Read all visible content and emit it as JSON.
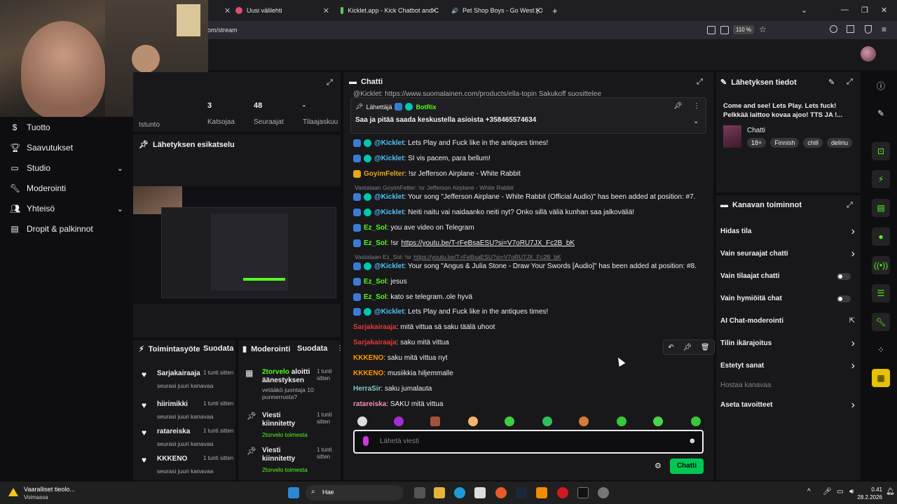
{
  "browser": {
    "tabs": [
      {
        "label": "Uusi välilehti"
      },
      {
        "label": "Kicklet.app - Kick Chatbot and C"
      },
      {
        "label": "Pet Shop Boys - Go West (Of"
      }
    ],
    "new_tab": "+",
    "url": "om/stream",
    "zoom": "110 %"
  },
  "leftnav": {
    "items": [
      {
        "label": "Tuotto",
        "icon": "dollar-icon"
      },
      {
        "label": "Saavutukset",
        "icon": "trophy-icon"
      },
      {
        "label": "Studio",
        "icon": "monitor-icon"
      },
      {
        "label": "Moderointi",
        "icon": "wrench-icon"
      },
      {
        "label": "Yhteisö",
        "icon": "users-icon"
      },
      {
        "label": "Dropit & palkinnot",
        "icon": "gift-icon"
      }
    ]
  },
  "stats": {
    "session_value": "3",
    "followers_value": "48",
    "subs_value": "-",
    "labels": [
      "Istunto",
      "Katsojaa",
      "Seuraajat",
      "Tilaajaskuu"
    ]
  },
  "preview": {
    "title": "Lähetyksen esikatselu"
  },
  "activity": {
    "title": "Toimintasyöte",
    "filter": "Suodata",
    "items": [
      {
        "name": "Sarjakairaaja",
        "time": "1 tunti sitten",
        "desc": "seurasi juuri kanavaa"
      },
      {
        "name": "hiirimikki",
        "time": "1 tunti sitten",
        "desc": "seurasi juuri kanavaa"
      },
      {
        "name": "ratareiska",
        "time": "1 tunti sitten",
        "desc": "seurasi juuri kanavaa"
      },
      {
        "name": "KKKENO",
        "time": "1 tunti sitten",
        "desc": "seurasi juuri kanavaa"
      }
    ]
  },
  "modlog": {
    "title": "Moderointi",
    "filter": "Suodata",
    "items": [
      {
        "user": "2torvelo",
        "text": "aloitti äänestyksen",
        "time": "1 tunti sitten",
        "desc": "vetääkö juontaja 10 punnerrusta?"
      },
      {
        "user": "",
        "text": "Viesti kiinnitetty",
        "time": "1 tunti sitten",
        "desc": "2torvelo toimesta"
      },
      {
        "user": "",
        "text": "Viesti kiinnitetty",
        "time": "1 tunti sitten",
        "desc": "2torvelo toimesta"
      }
    ]
  },
  "chat": {
    "title": "Chatti",
    "top_partial": "@Kicklet: https://www.suomalainen.com/products/ella-topin Sakukoff suosittelee",
    "pinned": {
      "sender_label": "Lähettäjä",
      "sender": "BotRix",
      "message": "Saa ja pitää saada keskustella asioista +358465574634"
    },
    "messages": [
      {
        "user": "@Kicklet",
        "color": "#4fc3f7",
        "text": ": Lets Play and Fuck like in the antiques times!"
      },
      {
        "user": "@Kicklet",
        "color": "#4fc3f7",
        "text": ": SI vis pacem, para bellum!"
      },
      {
        "user": "GoyimFelter",
        "color": "#e6a817",
        "text": ": !sr Jefferson Airplane - White Rabbit"
      },
      {
        "reply": "Vastataan GoyimFelter: !sr Jefferson Airplane - White Rabbit"
      },
      {
        "user": "@Kicklet",
        "color": "#4fc3f7",
        "text": ": Your song \"Jefferson Airplane - White Rabbit (Official Audio)\" has been added at position: #7."
      },
      {
        "user": "@Kicklet",
        "color": "#4fc3f7",
        "text": ": Neiti naitu vai naidaanko neiti nyt? Onko sillä väliä kunhan saa jalkoväliä!"
      },
      {
        "user": "Ez_Sol",
        "color": "#53fc18",
        "text": ": you ave video on Telegram"
      },
      {
        "user": "Ez_Sol",
        "color": "#53fc18",
        "text": ": !sr",
        "link": "https://youtu.be/T-rFeBsaESU?si=V7oRU7JX_Fc2B_bK"
      },
      {
        "reply": "Vastataan Ez_Sol: !sr",
        "reply_link": "https://youtu.be/T-rFeBsaESU?si=V7oRU7JX_Fc2B_bK"
      },
      {
        "user": "@Kicklet",
        "color": "#4fc3f7",
        "text": ": Your song \"Angus & Julia Stone - Draw Your Swords [Audio]\" has been added at position: #8."
      },
      {
        "user": "Ez_Sol",
        "color": "#53fc18",
        "text": ": jesus"
      },
      {
        "user": "Ez_Sol",
        "color": "#53fc18",
        "text": ": kato se telegram..ole hyvä"
      },
      {
        "user": "@Kicklet",
        "color": "#4fc3f7",
        "text": ": Lets Play and Fuck like in the antiques times!"
      },
      {
        "user": "Sarjakairaaja",
        "color": "#e53935",
        "text": ": mitä vittua sä saku täälä uhoot"
      },
      {
        "user": "Sarjakairaaja",
        "color": "#e53935",
        "text": ": saku mitä vittua"
      },
      {
        "user": "KKKENO",
        "color": "#ff9800",
        "text": ": saku mitä vittua nyt"
      },
      {
        "user": "KKKENO",
        "color": "#ff9800",
        "text": ": musiikkia hiljemmalle"
      },
      {
        "user": "HerraSir",
        "color": "#80cbc4",
        "text": ": saku jumalauta"
      },
      {
        "user": "ratareiska",
        "color": "#f48fb1",
        "text": ": SAKU mitä vittua"
      }
    ],
    "input_placeholder": "Lähetä viesti",
    "send_label": "Chatti"
  },
  "streaminfo": {
    "title": "Lähetyksen tiedot",
    "stream_title": "Come and see! Lets Play. Lets fuck! Pelkkää laittoo kovaa ajoo! TTS JA !...",
    "category": "Chatti",
    "tags": [
      "18+",
      "Finnish",
      "chill",
      "deliriu"
    ]
  },
  "channelactions": {
    "title": "Kanavan toiminnot",
    "items": [
      {
        "label": "Hidas tila",
        "control": "chevron"
      },
      {
        "label": "Vain seuraajat chatti",
        "control": "chevron"
      },
      {
        "label": "Vain tilaajat chatti",
        "control": "toggle"
      },
      {
        "label": "Vain hymiöitä chat",
        "control": "toggle"
      },
      {
        "label": "AI Chat-moderointi",
        "control": "external"
      },
      {
        "label": "Tilin ikärajoitus",
        "control": "chevron"
      },
      {
        "label": "Estetyt sanat",
        "control": "chevron"
      },
      {
        "label": "Hostaa kanavaa",
        "control": "none"
      },
      {
        "label": "Aseta tavoitteet",
        "control": "chevron"
      }
    ]
  },
  "taskbar": {
    "warning_title": "Vaaralliset tieolo...",
    "warning_sub": "Voimassa",
    "search": "Hae",
    "time": "0.41",
    "date": "28.2.2026"
  },
  "colors": {
    "accent": "#53fc18",
    "bg": "#0e0e10",
    "panel": "#18181b"
  }
}
